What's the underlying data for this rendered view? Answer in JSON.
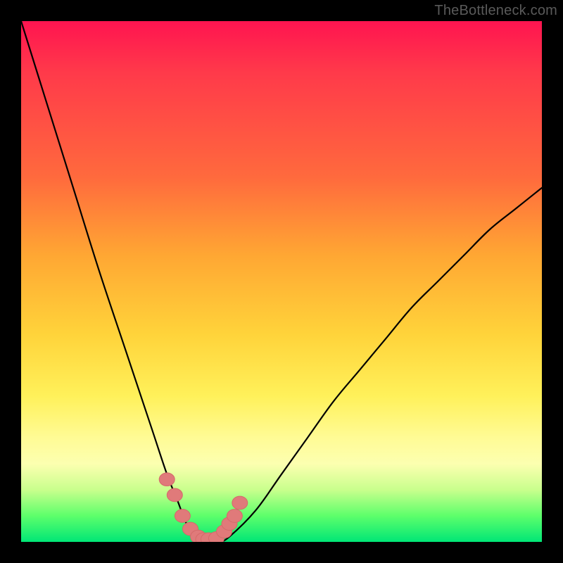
{
  "watermark": "TheBottleneck.com",
  "chart_data": {
    "type": "line",
    "title": "",
    "xlabel": "",
    "ylabel": "",
    "xlim": [
      0,
      100
    ],
    "ylim": [
      0,
      100
    ],
    "grid": false,
    "legend": "none",
    "background_gradient": {
      "top_color": "#ff1450",
      "bottom_color": "#00e676",
      "meaning": "bottleneck severity (top=high, bottom=none)"
    },
    "series": [
      {
        "name": "bottleneck-curve",
        "x": [
          0,
          5,
          10,
          15,
          20,
          25,
          28,
          30,
          32,
          34,
          36,
          38,
          40,
          45,
          50,
          55,
          60,
          65,
          70,
          75,
          80,
          85,
          90,
          95,
          100
        ],
        "values": [
          100,
          84,
          68,
          52,
          37,
          22,
          13,
          8,
          3,
          1,
          0,
          0,
          1,
          6,
          13,
          20,
          27,
          33,
          39,
          45,
          50,
          55,
          60,
          64,
          68
        ]
      }
    ],
    "scatter_points": {
      "name": "highlighted-range",
      "x": [
        28,
        29.5,
        31,
        32.5,
        34,
        35,
        36,
        37.5,
        39,
        40,
        41,
        42
      ],
      "values": [
        12,
        9,
        5,
        2.5,
        1,
        0.5,
        0.5,
        0.7,
        2,
        3.5,
        5,
        7.5
      ]
    }
  }
}
